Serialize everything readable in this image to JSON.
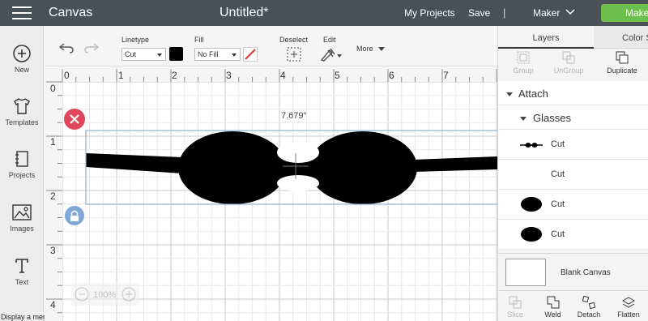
{
  "topbar": {
    "app_title": "Canvas",
    "doc_title": "Untitled*",
    "my_projects": "My Projects",
    "save": "Save",
    "divider": "|",
    "machine": "Maker",
    "make": "Make"
  },
  "sidebar": {
    "items": [
      {
        "label": "New",
        "icon": "plus-circle-icon"
      },
      {
        "label": "Templates",
        "icon": "tshirt-icon"
      },
      {
        "label": "Projects",
        "icon": "notebook-icon"
      },
      {
        "label": "Images",
        "icon": "image-icon"
      },
      {
        "label": "Text",
        "icon": "text-icon"
      }
    ],
    "hint": "Display a menu"
  },
  "toolbar": {
    "linetype_label": "Linetype",
    "linetype_value": "Cut",
    "fill_label": "Fill",
    "fill_value": "No Fill",
    "deselect_label": "Deselect",
    "edit_label": "Edit",
    "more_label": "More",
    "linetype_color": "#000000",
    "fill_swatch_color": "#ffffff",
    "fill_strike_color": "#d93a3a"
  },
  "canvas": {
    "ruler_top": [
      "0",
      "1",
      "2",
      "3",
      "4",
      "5",
      "6",
      "7"
    ],
    "ruler_left": [
      "0",
      "1",
      "2",
      "3",
      "4"
    ],
    "dimension_width": "7.679\"",
    "zoom": "100%",
    "selection_color": "#8fb0d6",
    "delete_handle_color": "#e0475a",
    "lock_handle_color": "#7fa8d8"
  },
  "layers_panel": {
    "tabs": [
      "Layers",
      "Color S"
    ],
    "actions_top": [
      {
        "label": "Group",
        "enabled": false
      },
      {
        "label": "UnGroup",
        "enabled": false
      },
      {
        "label": "Duplicate",
        "enabled": true
      }
    ],
    "attach_label": "Attach",
    "group_label": "Glasses",
    "layers": [
      {
        "label": "Cut",
        "icon": "glasses-thumbnail-icon"
      },
      {
        "label": "Cut",
        "icon": "blank-thumbnail-icon"
      },
      {
        "label": "Cut",
        "icon": "ellipse-thumbnail-icon"
      },
      {
        "label": "Cut",
        "icon": "ellipse-thumbnail-icon"
      }
    ],
    "blank_canvas": "Blank Canvas",
    "actions_bottom": [
      {
        "label": "Slice",
        "enabled": false
      },
      {
        "label": "Weld",
        "enabled": true
      },
      {
        "label": "Detach",
        "enabled": true
      },
      {
        "label": "Flatten",
        "enabled": true
      }
    ]
  }
}
